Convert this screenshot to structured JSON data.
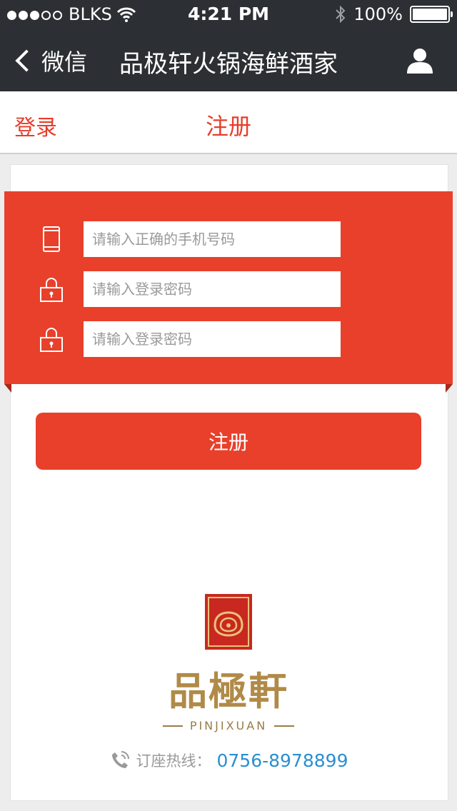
{
  "status_bar": {
    "carrier": "BLKS",
    "time": "4:21 PM",
    "battery": "100%"
  },
  "nav": {
    "back_label": "微信",
    "title": "品极轩火锅海鲜酒家"
  },
  "tabs": {
    "login": "登录",
    "register": "注册"
  },
  "form": {
    "phone_placeholder": "请输入正确的手机号码",
    "password_placeholder": "请输入登录密码",
    "confirm_placeholder": "请输入登录密码",
    "submit_label": "注册"
  },
  "logo": {
    "cn": "品極軒",
    "en": "PINJIXUAN"
  },
  "hotline": {
    "label": "订座热线：",
    "number": "0756-8978899"
  },
  "colors": {
    "accent": "#e8402b",
    "nav_bg": "#2c2f33",
    "link": "#2a8fd0",
    "gold": "#b08a48"
  }
}
